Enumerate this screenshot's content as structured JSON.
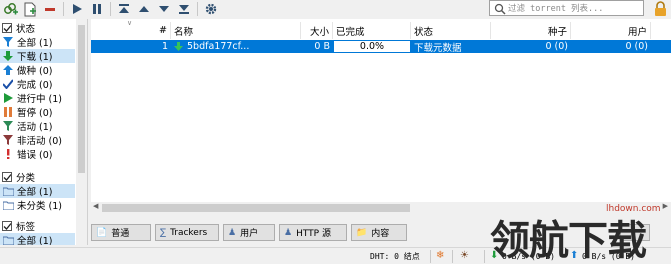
{
  "toolbar": {
    "buttons": [
      "add-torrent-link",
      "add-torrent-file",
      "remove",
      "resume",
      "pause",
      "move-top",
      "move-up",
      "move-down",
      "move-bottom",
      "options"
    ]
  },
  "search": {
    "placeholder": "过滤 torrent 列表..."
  },
  "sidebar": {
    "status_header": "状态",
    "status_items": [
      {
        "label": "全部 (1)",
        "icon": "filter-icon",
        "color": "#1a7fd4"
      },
      {
        "label": "下载 (1)",
        "icon": "arrow-down-icon",
        "color": "#1e9b3a"
      },
      {
        "label": "做种 (0)",
        "icon": "arrow-up-icon",
        "color": "#1a7fd4"
      },
      {
        "label": "完成 (0)",
        "icon": "check-icon",
        "color": "#1a4fa8"
      },
      {
        "label": "进行中 (1)",
        "icon": "play-icon",
        "color": "#1e9b3a"
      },
      {
        "label": "暂停 (0)",
        "icon": "pause-icon",
        "color": "#e07b39"
      },
      {
        "label": "活动 (1)",
        "icon": "filter-icon",
        "color": "#2e8b57"
      },
      {
        "label": "非活动 (0)",
        "icon": "filter-icon",
        "color": "#8b3a3a"
      },
      {
        "label": "错误 (0)",
        "icon": "exclamation-icon",
        "color": "#d32f2f"
      }
    ],
    "category_header": "分类",
    "category_items": [
      {
        "label": "全部 (1)",
        "icon": "folder-icon"
      },
      {
        "label": "未分类 (1)",
        "icon": "folder-icon"
      }
    ],
    "tags_header": "标签",
    "tag_items": [
      {
        "label": "全部 (1)",
        "icon": "folder-icon"
      }
    ]
  },
  "table": {
    "columns": [
      "#",
      "名称",
      "大小",
      "已完成",
      "状态",
      "种子",
      "用户"
    ],
    "rows": [
      {
        "num": "1",
        "name": "5bdfa177cf...",
        "size": "0 B",
        "progress": "0.0%",
        "status": "下载元数据",
        "seeds": "0 (0)",
        "peers": "0 (0)"
      }
    ]
  },
  "tabs": [
    {
      "label": "普通",
      "icon": "info-icon"
    },
    {
      "label": "Trackers",
      "icon": "tracker-icon"
    },
    {
      "label": "用户",
      "icon": "users-icon"
    },
    {
      "label": "HTTP 源",
      "icon": "http-icon"
    },
    {
      "label": "内容",
      "icon": "folder-icon"
    }
  ],
  "statusbar": {
    "dht": "DHT: 0 结点",
    "down": "0 B/s (0 B)",
    "up": "0 B/s (0 B)"
  },
  "watermark": {
    "text": "领航下载",
    "site": "lhdown.com"
  }
}
